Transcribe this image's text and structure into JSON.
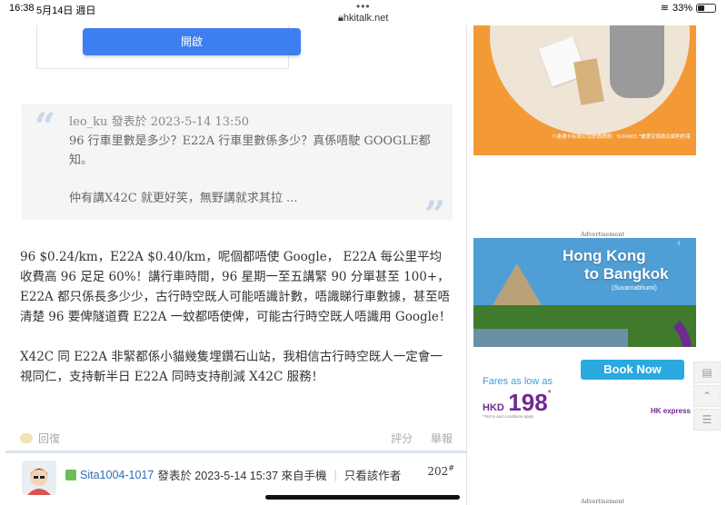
{
  "status_bar": {
    "time": "16:38",
    "date": "5月14日 週日",
    "url": "hkitalk.net",
    "battery": "33%"
  },
  "open_button": {
    "label": "開啟"
  },
  "quote": {
    "author": "leo_ku",
    "meta": " 發表於 2023-5-14 13:50",
    "line1": "96 行車里數是多少？E22A 行車里數係多少？真係唔駛 GOOGLE都知。",
    "line2": "仲有講X42C 就更好笑，無野講就求其拉 ..."
  },
  "post_body": {
    "paragraph1": "96 $0.24/km，E22A $0.40/km，呢個都唔使 Google， E22A 每公里平均收費高 96 足足 60%！講行車時間，96 星期一至五講緊 90 分單甚至 100+，E22A 都只係長多少少，古行時空既人可能唔識計數，唔識睇行車數據，甚至唔清楚 96 要俾隧道費 E22A 一蚊都唔使俾，可能古行時空既人唔識用 Google！",
    "paragraph2": "X42C 同 E22A 非緊都係小貓幾隻埋鑽石山站，我相信古行時空既人一定會一視同仁，支持斬半日 E22A 同時支持削減 X42C 服務！"
  },
  "post_actions": {
    "reply": "回復",
    "rate": "評分",
    "report": "舉報"
  },
  "next_post": {
    "username": "Sita1004-1017",
    "meta": " 發表於 2023-5-14 15:37 來自手機",
    "only_author": "只看該作者",
    "floor": "202",
    "floor_sup": "#"
  },
  "ads": {
    "label_top": "Advertisement",
    "label_bottom": "Advertisement",
    "top_fine_print": "八達通卡有限公司放債牌照：SVF0001 *優惠受條款及細則約束",
    "hk": {
      "title_line1": "Hong Kong",
      "title_line2": "to Bangkok",
      "subtitle": "(Suvarnabhumi)",
      "book_now": "Book Now",
      "fares_as_low_as": "Fares as low as",
      "currency": "HKD",
      "price": "198",
      "price_mark": "*",
      "terms": "*Terms and conditions apply",
      "brand": "HK express"
    }
  },
  "colors": {
    "primary_button": "#3d7ff0",
    "link": "#2a6eb7",
    "ad_purple": "#6f2a91",
    "ad_orange": "#f39a37"
  }
}
